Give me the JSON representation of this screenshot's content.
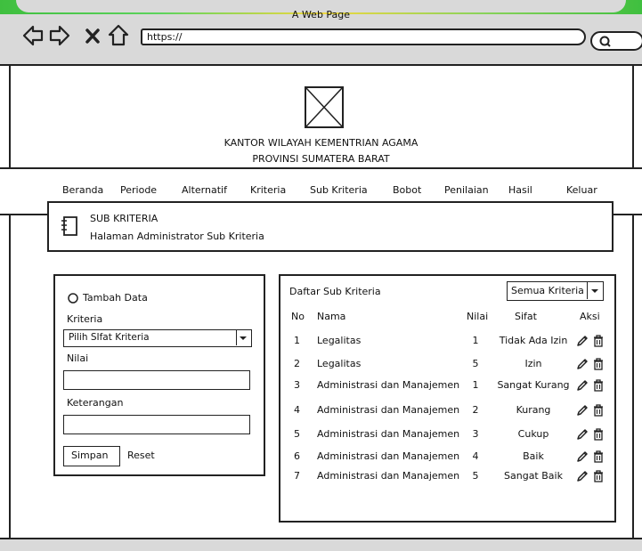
{
  "browser": {
    "window_title": "A Web Page",
    "url": "https://"
  },
  "header": {
    "org_line1": "KANTOR WILAYAH KEMENTRIAN AGAMA",
    "org_line2": "PROVINSI SUMATERA BARAT"
  },
  "nav": {
    "items": [
      "Beranda",
      "Periode",
      "Alternatif",
      "Kriteria",
      "Sub Kriteria",
      "Bobot",
      "Penilaian",
      "Hasil",
      "Keluar"
    ]
  },
  "banner": {
    "title": "SUB KRITERIA",
    "subtitle": "Halaman Administrator Sub Kriteria",
    "icon": "notebook-icon"
  },
  "form": {
    "radio_label": "Tambah Data",
    "kriteria_label": "Kriteria",
    "kriteria_select_value": "Pilih SIfat Kriteria",
    "nilai_label": "Nilai",
    "nilai_value": "",
    "keterangan_label": "Keterangan",
    "keterangan_value": "",
    "save_label": "Simpan",
    "reset_label": "Reset"
  },
  "table": {
    "title": "Daftar Sub Kriteria",
    "filter_value": "Semua Kriteria",
    "columns": [
      "No",
      "Nama",
      "Nilai",
      "Sifat",
      "Aksi"
    ],
    "rows": [
      {
        "no": "1",
        "nama": "Legalitas",
        "nilai": "1",
        "sifat": "Tidak Ada Izin"
      },
      {
        "no": "2",
        "nama": "Legalitas",
        "nilai": "5",
        "sifat": "Izin"
      },
      {
        "no": "3",
        "nama": "Administrasi dan Manajemen",
        "nilai": "1",
        "sifat": "Sangat Kurang"
      },
      {
        "no": "4",
        "nama": "Administrasi dan Manajemen",
        "nilai": "2",
        "sifat": "Kurang"
      },
      {
        "no": "5",
        "nama": "Administrasi dan Manajemen",
        "nilai": "3",
        "sifat": "Cukup"
      },
      {
        "no": "6",
        "nama": "Administrasi dan Manajemen",
        "nilai": "4",
        "sifat": "Baik"
      },
      {
        "no": "7",
        "nama": "Administrasi dan Manajemen",
        "nilai": "5",
        "sifat": "Sangat Baik"
      }
    ],
    "row_actions": [
      "edit-pencil-icon",
      "delete-trash-icon"
    ]
  }
}
